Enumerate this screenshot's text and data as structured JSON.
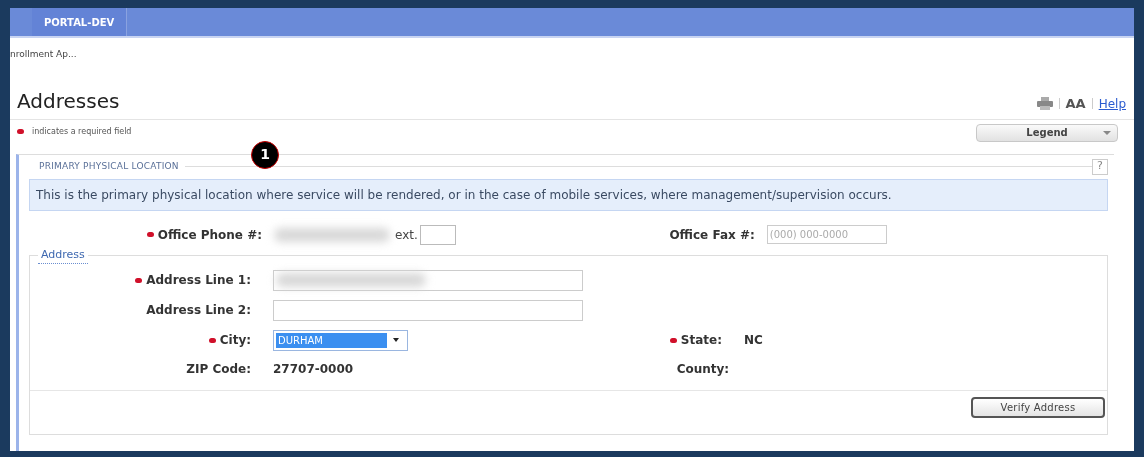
{
  "tab": {
    "label": "PORTAL-DEV"
  },
  "breadcrumb": "nrollment Ap...",
  "title": "Addresses",
  "tools": {
    "font_size": "AA",
    "help": "Help"
  },
  "required_note": "indicates a required field",
  "legend_dropdown": {
    "label": "Legend"
  },
  "marker": "1",
  "section": {
    "title": "PRIMARY PHYSICAL LOCATION",
    "help": "?",
    "info": "This is the primary physical location where service will be rendered, or in the case of mobile services, where management/supervision occurs.",
    "phone": {
      "label": "Office Phone #:",
      "required": true,
      "ext_label": "ext."
    },
    "fax": {
      "label": "Office Fax #:",
      "required": false,
      "placeholder": "(000) 000-0000"
    },
    "address": {
      "title": "Address",
      "line1": {
        "label": "Address Line 1:",
        "required": true
      },
      "line2": {
        "label": "Address Line 2:",
        "required": false
      },
      "city": {
        "label": "City:",
        "required": true,
        "value": "DURHAM"
      },
      "state": {
        "label": "State:",
        "required": true,
        "value": "NC"
      },
      "zip": {
        "label": "ZIP Code:",
        "required": false,
        "value": "27707-0000"
      },
      "county": {
        "label": "County:",
        "required": false
      },
      "verify_button": "Verify Address"
    }
  }
}
